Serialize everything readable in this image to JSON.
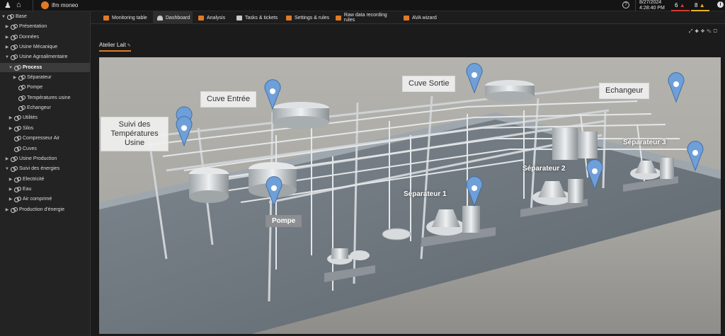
{
  "topbar": {
    "app_name": "ifm moneo",
    "date": "8/27/2024",
    "time": "4:28:40 PM",
    "alarm_red_count": "6",
    "alarm_yellow_count": "8",
    "icons": [
      "user-icon",
      "home-icon",
      "app-logo-icon",
      "help-icon",
      "alarm-icon",
      "warning-icon",
      "info-icon"
    ],
    "colors": {
      "accent": "#e07a26",
      "alarm_red": "#d23b32",
      "alarm_yellow": "#e6b320"
    }
  },
  "sidebar": {
    "items": [
      {
        "label": "Base",
        "level": 0,
        "expanded": true
      },
      {
        "label": "Présentation",
        "level": 1,
        "expanded": false
      },
      {
        "label": "Données",
        "level": 1,
        "expanded": false
      },
      {
        "label": "Usine Mécanique",
        "level": 1,
        "expanded": false
      },
      {
        "label": "Usine Agroalimentaire",
        "level": 1,
        "expanded": true
      },
      {
        "label": "Process",
        "level": 2,
        "expanded": true,
        "selected": true
      },
      {
        "label": "Séparateur",
        "level": 3,
        "expanded": false
      },
      {
        "label": "Pompe",
        "level": 3
      },
      {
        "label": "Températures usine",
        "level": 3
      },
      {
        "label": "Echangeur",
        "level": 3
      },
      {
        "label": "Utilités",
        "level": 2,
        "expanded": false
      },
      {
        "label": "Silos",
        "level": 2,
        "expanded": false
      },
      {
        "label": "Compresseur Air",
        "level": 2
      },
      {
        "label": "Cuves",
        "level": 2
      },
      {
        "label": "Usine Production",
        "level": 1,
        "expanded": false
      },
      {
        "label": "Suivi des énergies",
        "level": 1,
        "expanded": true
      },
      {
        "label": "Electricité",
        "level": 2,
        "expanded": false
      },
      {
        "label": "Eau",
        "level": 2,
        "expanded": false
      },
      {
        "label": "Air comprimé",
        "level": 2,
        "expanded": false
      },
      {
        "label": "Production d'énergie",
        "level": 1,
        "expanded": false
      }
    ]
  },
  "tabs": [
    {
      "label": "Monitoring table",
      "icon": "table-icon",
      "active": false,
      "color": "#e07a26"
    },
    {
      "label": "Dashboard",
      "icon": "gauge-icon",
      "active": true,
      "color": "#c9c9c9"
    },
    {
      "label": "Analysis",
      "icon": "analysis-icon",
      "active": false,
      "color": "#e07a26"
    },
    {
      "label": "Tasks & tickets",
      "icon": "tasks-icon",
      "active": false,
      "color": "#c9c9c9"
    },
    {
      "label": "Settings & rules",
      "icon": "settings-icon",
      "active": false,
      "color": "#e07a26"
    },
    {
      "label": "Raw data recording rules",
      "icon": "recording-icon",
      "active": false,
      "color": "#e07a26"
    },
    {
      "label": "AVA wizard",
      "icon": "wizard-icon",
      "active": false,
      "color": "#e07a26"
    }
  ],
  "dashboard": {
    "title": "Atelier Lait",
    "toolbar_icons": [
      "fullscreen-icon",
      "add-icon",
      "pin-icon",
      "edit-icon",
      "delete-icon"
    ],
    "labels": {
      "suivi": "Suivi des Températures Usine",
      "cuve_entree": "Cuve Entrée",
      "cuve_sortie": "Cuve Sortie",
      "echangeur": "Echangeur",
      "pompe": "Pompe",
      "separateur1": "Séparateur 1",
      "separateur2": "Séparateur 2",
      "separateur3": "Séparateur 3"
    }
  }
}
